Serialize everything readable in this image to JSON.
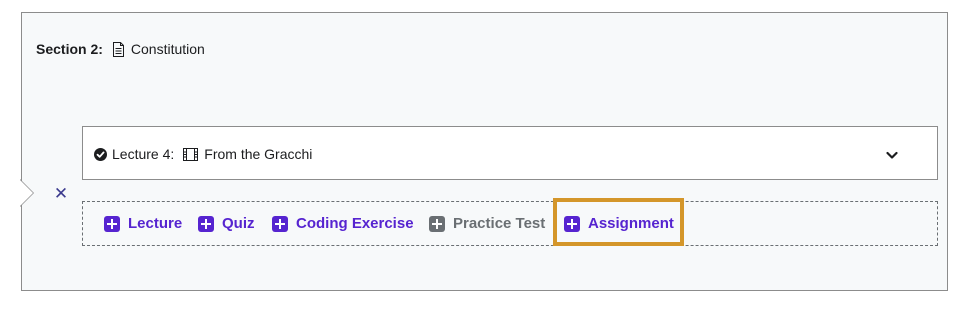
{
  "section": {
    "prefix": "Section 2:",
    "title": "Constitution",
    "icon": "document-icon"
  },
  "lecture": {
    "prefix": "Lecture 4:",
    "title": "From the Gracchi",
    "status_icon": "check-circle-icon",
    "type_icon": "film-icon",
    "expand_icon": "chevron-down-icon"
  },
  "close_icon": "close-icon",
  "add_items": [
    {
      "label": "Lecture",
      "enabled": true
    },
    {
      "label": "Quiz",
      "enabled": true
    },
    {
      "label": "Coding Exercise",
      "enabled": true
    },
    {
      "label": "Practice Test",
      "enabled": false
    },
    {
      "label": "Assignment",
      "enabled": true,
      "highlighted": true
    }
  ],
  "colors": {
    "accent": "#5624d0",
    "disabled": "#6a6f73",
    "highlight": "#d4962a",
    "close": "#3c3b8e",
    "section_bg": "#f7f9fa"
  }
}
